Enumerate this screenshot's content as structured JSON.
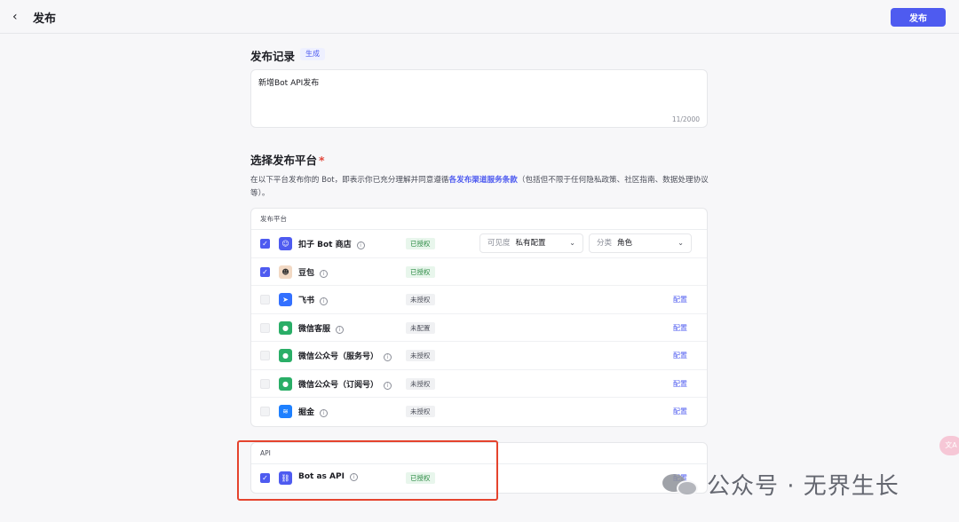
{
  "header": {
    "back_icon": "‹",
    "title": "发布",
    "publish_label": "发布"
  },
  "record": {
    "title": "发布记录",
    "gen_label": "生成",
    "value": "新增Bot API发布",
    "count": "11/2000"
  },
  "platform": {
    "title": "选择发布平台",
    "required_mark": "*",
    "desc_pre": "在以下平台发布你的 Bot，即表示你已充分理解并同意遵循",
    "desc_link": "各发布渠道服务条款",
    "desc_post": "（包括但不限于任何隐私政策、社区指南、数据处理协议等）。",
    "section_label": "发布平台",
    "visibility_label": "可见度",
    "visibility_value": "私有配置",
    "category_label": "分类",
    "category_value": "角色",
    "config_label": "配置",
    "rows": [
      {
        "name": "扣子 Bot 商店",
        "status": "已授权",
        "checked": true,
        "icon": "coze-icon",
        "icon_color": "#4e5bf0"
      },
      {
        "name": "豆包",
        "status": "已授权",
        "checked": true,
        "icon": "doubao-icon",
        "icon_color": "#f2d9c4"
      },
      {
        "name": "飞书",
        "status": "未授权",
        "checked": false,
        "icon": "feishu-icon",
        "icon_color": "#3370ff"
      },
      {
        "name": "微信客服",
        "status": "未配置",
        "checked": false,
        "icon": "wechat-icon",
        "icon_color": "#2aae67"
      },
      {
        "name": "微信公众号（服务号）",
        "status": "未授权",
        "checked": false,
        "icon": "wechat-icon",
        "icon_color": "#2aae67"
      },
      {
        "name": "微信公众号（订阅号）",
        "status": "未授权",
        "checked": false,
        "icon": "wechat-icon",
        "icon_color": "#2aae67"
      },
      {
        "name": "掘金",
        "status": "未授权",
        "checked": false,
        "icon": "juejin-icon",
        "icon_color": "#1e80ff"
      }
    ]
  },
  "api": {
    "section_label": "API",
    "name": "Bot as API",
    "status": "已授权",
    "config_label": "配置",
    "icon": "link-icon",
    "icon_color": "#4e5bf0"
  },
  "float_label": "文A",
  "watermark": "公众号 · 无界生长"
}
